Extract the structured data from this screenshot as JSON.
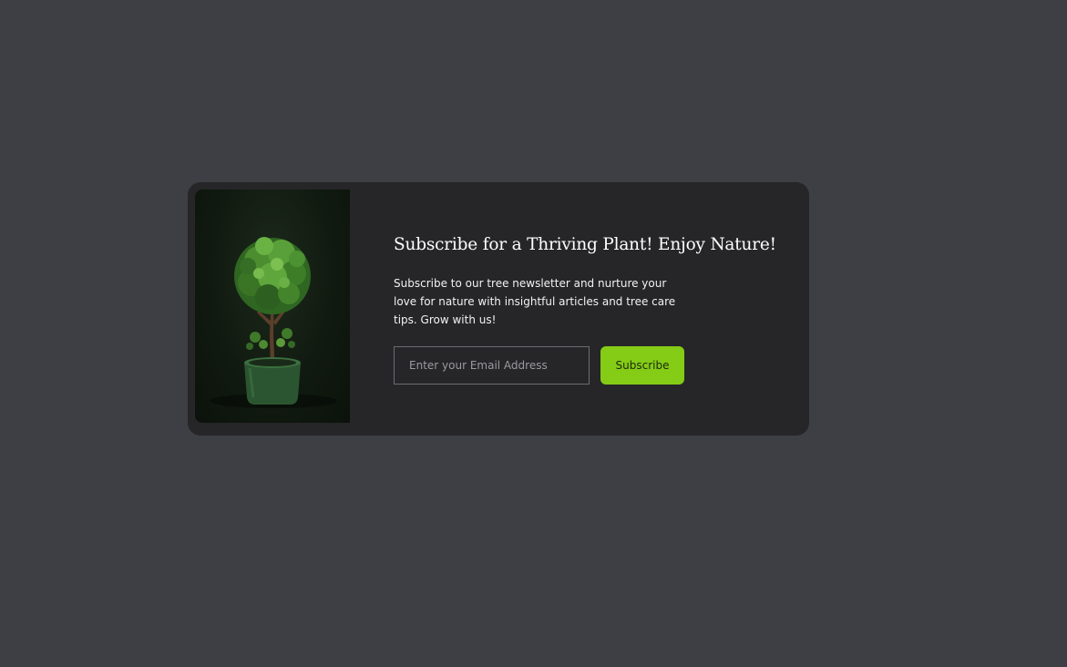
{
  "newsletter": {
    "title": "Subscribe for a Thriving Plant! Enjoy Nature!",
    "description": "Subscribe to our tree newsletter and nurture your love for nature with insightful articles and tree care tips. Grow with us!",
    "email_placeholder": "Enter your Email Address",
    "subscribe_label": "Subscribe"
  },
  "colors": {
    "page_background": "#3e3f44",
    "card_background": "#262628",
    "accent": "#84cc16",
    "pot": "#2f5a34"
  },
  "icons": {
    "photo": "topiary-plant-image"
  }
}
